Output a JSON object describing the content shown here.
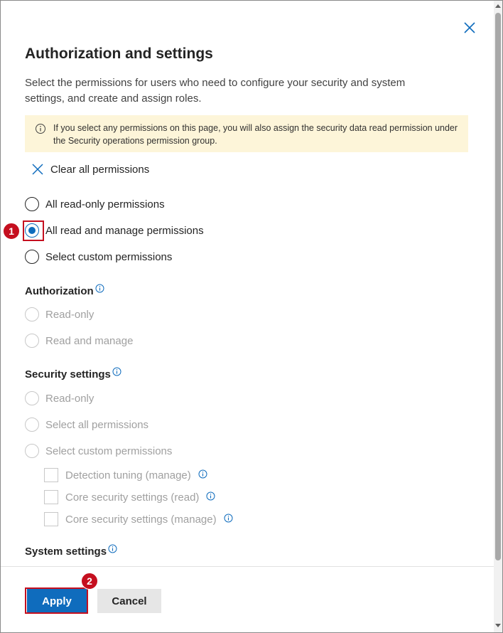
{
  "panel": {
    "title": "Authorization and settings",
    "description": "Select the permissions for users who need to configure your security and system settings, and create and assign roles.",
    "info_message": "If you select any permissions on this page, you will also assign the security data read permission under the Security operations permission group.",
    "clear_all_label": "Clear all permissions"
  },
  "global_options": [
    {
      "label": "All read-only permissions",
      "checked": false
    },
    {
      "label": "All read and manage permissions",
      "checked": true
    },
    {
      "label": "Select custom permissions",
      "checked": false
    }
  ],
  "authorization": {
    "heading": "Authorization",
    "options": [
      {
        "label": "Read-only",
        "disabled": true
      },
      {
        "label": "Read and manage",
        "disabled": true
      }
    ]
  },
  "security_settings": {
    "heading": "Security settings",
    "options": [
      {
        "label": "Read-only",
        "disabled": true
      },
      {
        "label": "Select all permissions",
        "disabled": true
      },
      {
        "label": "Select custom permissions",
        "disabled": true
      }
    ],
    "custom_checkboxes": [
      {
        "label": "Detection tuning (manage)",
        "checked": false
      },
      {
        "label": "Core security settings (read)",
        "checked": false
      },
      {
        "label": "Core security settings (manage)",
        "checked": false
      }
    ]
  },
  "system_settings": {
    "heading": "System settings"
  },
  "footer": {
    "apply_label": "Apply",
    "cancel_label": "Cancel"
  },
  "annotations": {
    "step1": "1",
    "step2": "2"
  },
  "colors": {
    "accent": "#0f6cbd",
    "info_bg": "#fdf5d9",
    "annotation_red": "#c50f1f"
  },
  "icons": {
    "close": "close-icon",
    "info": "info-icon",
    "clear": "x-icon"
  }
}
